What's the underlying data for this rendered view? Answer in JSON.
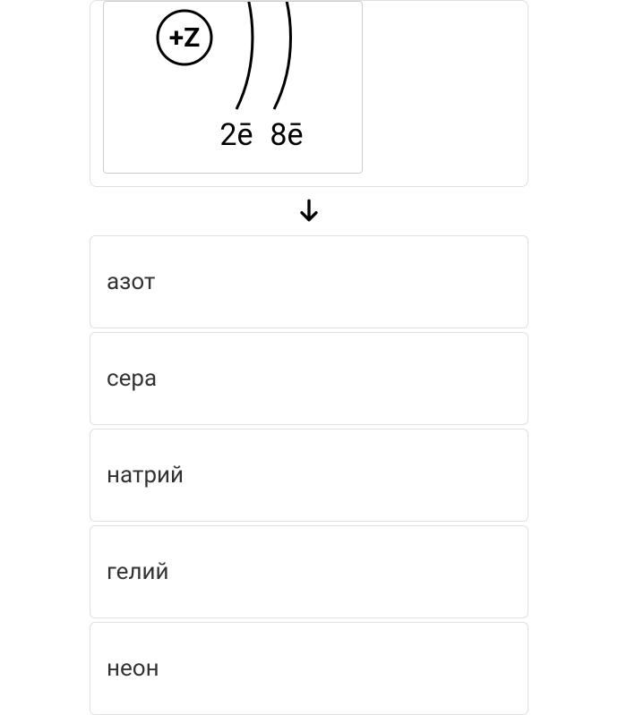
{
  "diagram": {
    "nucleus_label": "+Z",
    "shell_labels": [
      "2ē",
      "8ē"
    ]
  },
  "options": [
    {
      "label": "азот"
    },
    {
      "label": "сера"
    },
    {
      "label": "натрий"
    },
    {
      "label": "гелий"
    },
    {
      "label": "неон"
    }
  ]
}
